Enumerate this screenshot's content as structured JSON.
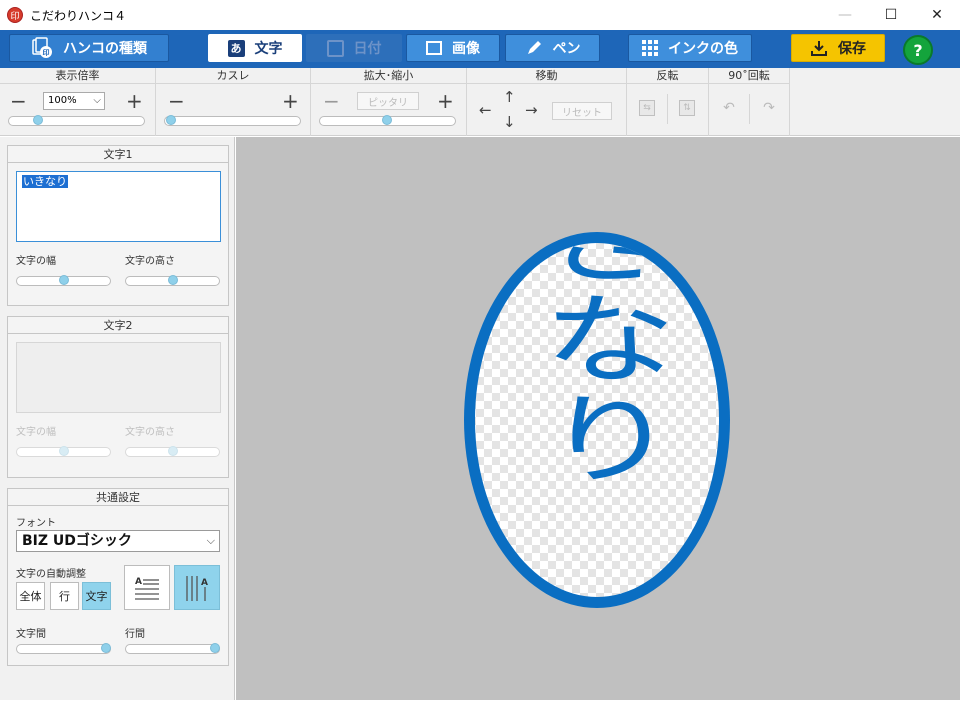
{
  "window": {
    "title": "こだわりハンコ４",
    "logo_text": "印",
    "controls": {
      "minimize": "—",
      "maximize": "☐",
      "close": "✕"
    }
  },
  "toolbar": {
    "hanko_type": "ハンコの種類",
    "moji": "文字",
    "moji_icon": "あ",
    "hizuke": "日付",
    "gazou": "画像",
    "pen": "ペン",
    "ink_color": "インクの色",
    "save": "保存",
    "help": "?"
  },
  "settings": {
    "zoom": {
      "header": "表示倍率",
      "value": "100%",
      "slider_level": 0.22
    },
    "kasure": {
      "header": "カスレ",
      "slider_level": 0.0
    },
    "scale": {
      "header": "拡大･縮小",
      "fit_label": "ピッタリ",
      "slider_level": 0.5
    },
    "move": {
      "header": "移動",
      "reset_label": "リセット"
    },
    "flip": {
      "header": "反転"
    },
    "rotate": {
      "header": "90˚回転"
    },
    "plus": "+",
    "minus": "−",
    "arrows": {
      "up": "↑",
      "down": "↓",
      "left": "←",
      "right": "→"
    }
  },
  "panel": {
    "text1": {
      "header": "文字1",
      "value": "いきなり",
      "width_label": "文字の幅",
      "height_label": "文字の高さ",
      "width_level": 0.5,
      "height_level": 0.5
    },
    "text2": {
      "header": "文字2",
      "value": "",
      "width_label": "文字の幅",
      "height_label": "文字の高さ",
      "width_level": 0.5,
      "height_level": 0.5
    },
    "common": {
      "header": "共通設定",
      "font_label": "フォント",
      "font_value": "BIZ UDゴシック",
      "auto_adjust_label": "文字の自動調整",
      "adjust_options": [
        "全体",
        "行",
        "文字"
      ],
      "adjust_selected": "文字",
      "char_spacing_label": "文字間",
      "line_spacing_label": "行間",
      "char_spacing_level": 1.0,
      "line_spacing_level": 1.0
    }
  },
  "stamp": {
    "text": "いきなり",
    "ink_color": "#0a6ec2",
    "shape": "ellipse",
    "orientation": "vertical"
  },
  "colors": {
    "title_bar": "#ffffff",
    "toolbar_blue": "#1e66b8",
    "button_blue": "#3f8fdc",
    "save_yellow": "#f5c400",
    "help_green": "#14a43c",
    "canvas_bg": "#c0c0c0",
    "knob": "#8fd0ea"
  }
}
